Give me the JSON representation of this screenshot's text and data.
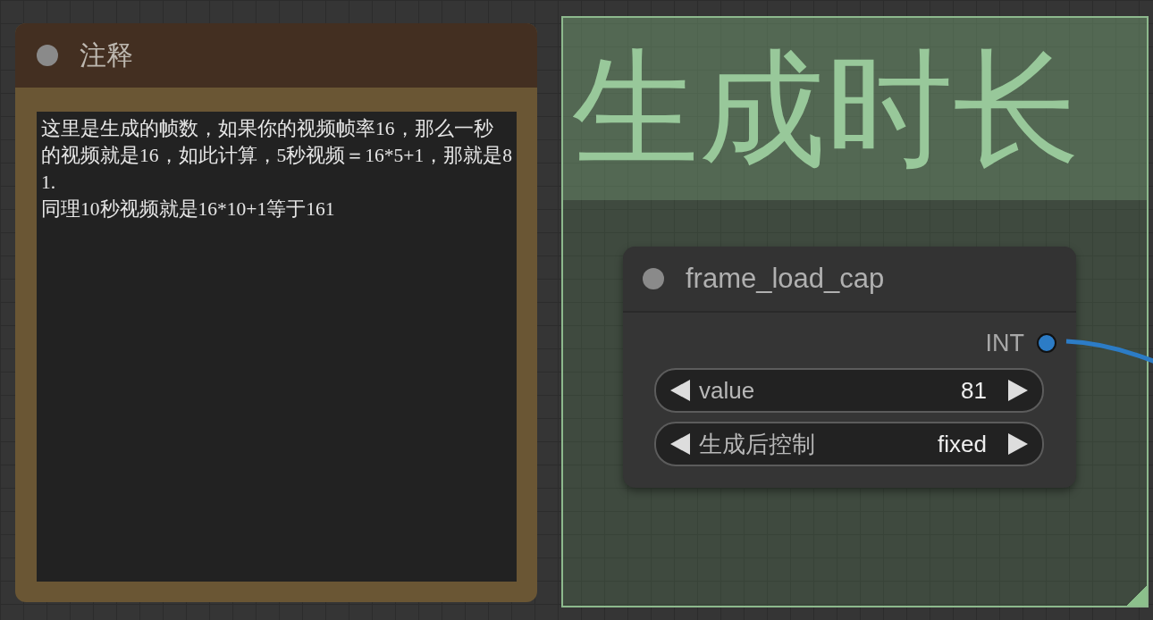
{
  "note": {
    "title": "注释",
    "text": "这里是生成的帧数，如果你的视频帧率16，那么一秒的视频就是16，如此计算，5秒视频＝16*5+1，那就是81.\n同理10秒视频就是16*10+1等于161"
  },
  "group": {
    "title": "生成时长"
  },
  "node": {
    "title": "frame_load_cap",
    "output": {
      "label": "INT"
    },
    "widgets": [
      {
        "label": "value",
        "value": "81"
      },
      {
        "label": "生成后控制",
        "value": "fixed"
      }
    ]
  }
}
